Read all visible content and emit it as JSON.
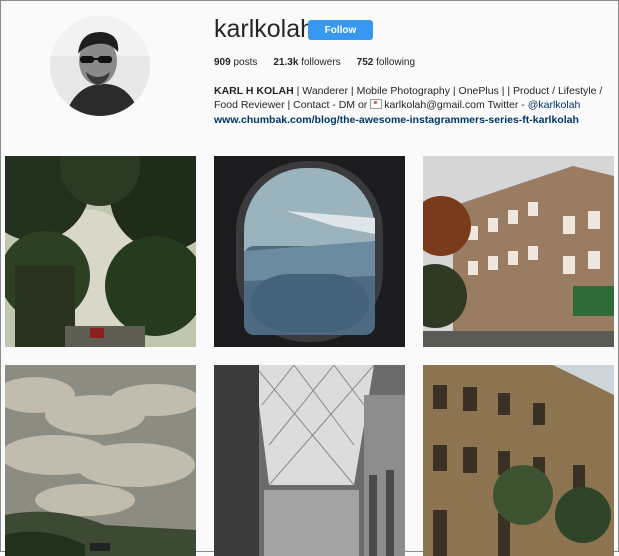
{
  "profile": {
    "username": "karlkolah",
    "follow_label": "Follow",
    "stats": {
      "posts_count": "909",
      "posts_label": "posts",
      "followers_count": "21.3k",
      "followers_label": "followers",
      "following_count": "752",
      "following_label": "following"
    },
    "bio": {
      "name": "KARL H KOLAH",
      "text": "| Wanderer | Mobile Photography | OnePlus | | Product / Lifestyle / Food Reviewer | Contact - DM or",
      "email": "karlkolah@gmail.com Twitter -",
      "twitter": "@karlkolah"
    },
    "website": "www.chumbak.com/blog/the-awesome-instagrammers-series-ft-karlkolah"
  },
  "colors": {
    "accent": "#3897f0",
    "link": "#003569",
    "background": "#fafafa"
  }
}
